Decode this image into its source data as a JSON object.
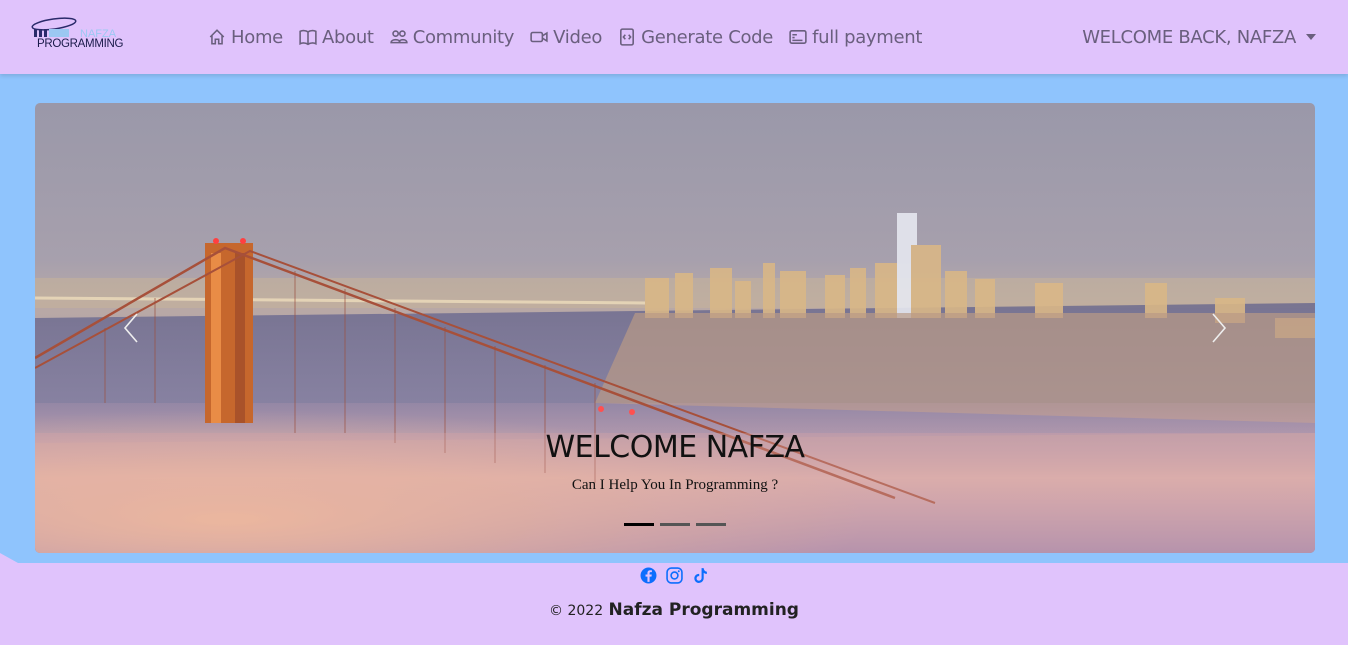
{
  "brand": {
    "logo_text_top": "NAFZA",
    "logo_text_bottom": "PROGRAMMING"
  },
  "nav": {
    "items": [
      {
        "label": "Home",
        "icon": "house-icon"
      },
      {
        "label": "About",
        "icon": "book-icon"
      },
      {
        "label": "Community",
        "icon": "people-icon"
      },
      {
        "label": "Video",
        "icon": "camera-video-icon"
      },
      {
        "label": "Generate Code",
        "icon": "file-code-icon"
      },
      {
        "label": "full payment",
        "icon": "credit-card-icon"
      }
    ],
    "user_menu": "WELCOME BACK, NAFZA"
  },
  "carousel": {
    "caption_title": "WELCOME NAFZA",
    "caption_text": "Can I Help You In Programming ?",
    "slides": 3,
    "active_slide": 1,
    "prev_icon": "chevron-left-icon",
    "next_icon": "chevron-right-icon"
  },
  "footer": {
    "socials": [
      "facebook-icon",
      "instagram-icon",
      "tiktok-icon"
    ],
    "copyright_symbol": "© 2022",
    "copyright_name": "Nafza Programming"
  },
  "colors": {
    "navbar_bg": "#e0c3fc",
    "page_bg": "#8fc4fd",
    "nav_text": "#6a5f7e",
    "social_icon": "#1877f2"
  }
}
